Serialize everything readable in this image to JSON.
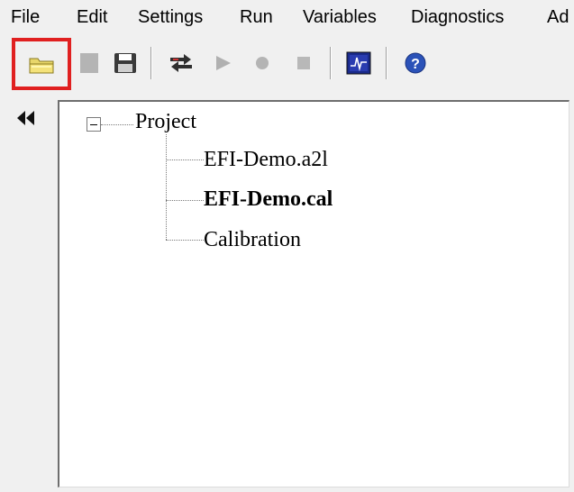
{
  "menu": {
    "items": [
      {
        "id": "file",
        "label": "File"
      },
      {
        "id": "edit",
        "label": "Edit"
      },
      {
        "id": "settings",
        "label": "Settings"
      },
      {
        "id": "run",
        "label": "Run"
      },
      {
        "id": "variables",
        "label": "Variables"
      },
      {
        "id": "diagnostics",
        "label": "Diagnostics"
      },
      {
        "id": "ad",
        "label": "Ad"
      }
    ]
  },
  "toolbar": {
    "buttons": [
      {
        "name": "open-project-button",
        "icon": "folder-open-icon",
        "highlighted": true
      },
      {
        "name": "new-button",
        "icon": "blank-document-icon",
        "enabled": false
      },
      {
        "name": "save-button",
        "icon": "floppy-disk-icon"
      },
      {
        "name": "connect-button",
        "icon": "connect-icon"
      },
      {
        "name": "run-button",
        "icon": "play-icon",
        "enabled": false
      },
      {
        "name": "record-button",
        "icon": "record-icon",
        "enabled": false
      },
      {
        "name": "stop-button",
        "icon": "stop-icon",
        "enabled": false
      },
      {
        "name": "scope-button",
        "icon": "oscilloscope-icon"
      },
      {
        "name": "help-button",
        "icon": "help-icon"
      }
    ],
    "highlight_color": "#e02020"
  },
  "panel": {
    "collapse_icon": "double-chevron-left-icon"
  },
  "tree": {
    "root": {
      "label": "Project",
      "expanded": true
    },
    "children": [
      {
        "label": "EFI-Demo.a2l",
        "bold": false
      },
      {
        "label": "EFI-Demo.cal",
        "bold": true
      },
      {
        "label": "Calibration",
        "bold": false
      }
    ]
  }
}
